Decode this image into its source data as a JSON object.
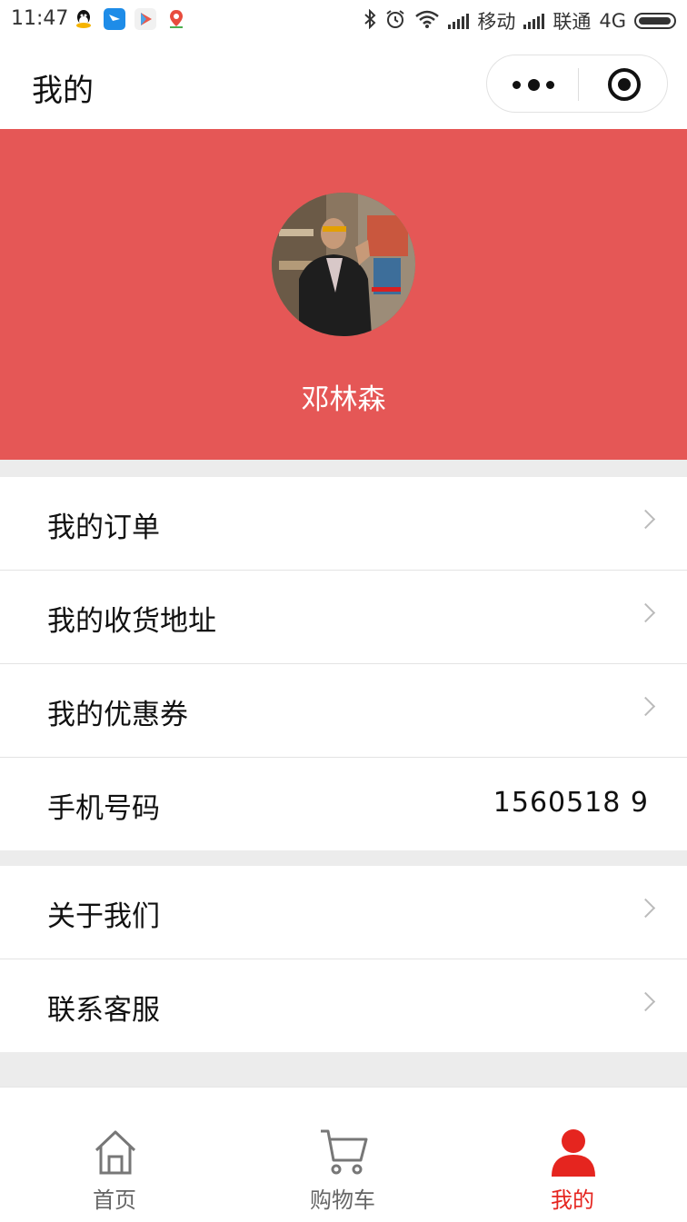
{
  "status_bar": {
    "time": "11:47",
    "carrier1": "移动",
    "carrier2": "联通",
    "network": "4G",
    "app_icons": [
      "qq-icon",
      "app-icon-blue",
      "play-store-icon",
      "map-pin-icon"
    ],
    "status_icons": [
      "bluetooth-icon",
      "alarm-icon",
      "wifi-icon",
      "signal-icon",
      "battery-icon"
    ]
  },
  "nav": {
    "title": "我的",
    "capsule_icons": [
      "more-icon",
      "target-icon"
    ]
  },
  "profile": {
    "username": "邓林森",
    "background_color": "#e55756"
  },
  "menu_groups": [
    [
      {
        "label": "我的订单",
        "has_arrow": true
      },
      {
        "label": "我的收货地址",
        "has_arrow": true
      },
      {
        "label": "我的优惠券",
        "has_arrow": true
      },
      {
        "label": "手机号码",
        "value": "1560518   9",
        "has_arrow": false
      }
    ],
    [
      {
        "label": "关于我们",
        "has_arrow": true
      },
      {
        "label": "联系客服",
        "has_arrow": true
      }
    ]
  ],
  "tabbar": {
    "tabs": [
      {
        "label": "首页",
        "icon": "home-icon",
        "active": false
      },
      {
        "label": "购物车",
        "icon": "cart-icon",
        "active": false
      },
      {
        "label": "我的",
        "icon": "user-icon",
        "active": true
      }
    ],
    "active_color": "#e5251f"
  }
}
